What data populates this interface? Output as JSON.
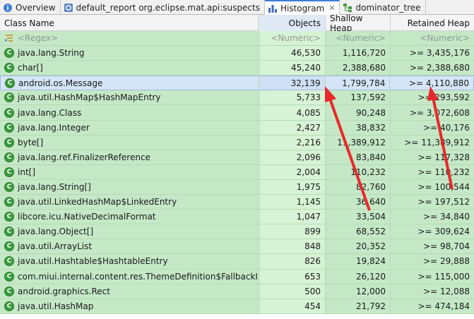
{
  "tabs": [
    {
      "label": "Overview",
      "icon": "info-icon",
      "active": false
    },
    {
      "label": "default_report  org.eclipse.mat.api:suspects",
      "icon": "report-icon",
      "active": false
    },
    {
      "label": "Histogram",
      "icon": "histogram-icon",
      "active": true,
      "close": "✕"
    },
    {
      "label": "dominator_tree",
      "icon": "tree-icon",
      "active": false
    }
  ],
  "columns": {
    "class_name": "Class Name",
    "objects": "Objects",
    "shallow_heap": "Shallow Heap",
    "retained_heap": "Retained Heap"
  },
  "filter_row": {
    "class_name": "<Regex>",
    "objects": "<Numeric>",
    "shallow_heap": "<Numeric>",
    "retained_heap": "<Numeric>"
  },
  "rows": [
    {
      "name": "java.lang.String",
      "objects": "46,530",
      "shallow": "1,116,720",
      "retained": ">= 3,435,176"
    },
    {
      "name": "char[]",
      "objects": "45,240",
      "shallow": "2,388,680",
      "retained": ">= 2,388,680"
    },
    {
      "name": "android.os.Message",
      "objects": "32,139",
      "shallow": "1,799,784",
      "retained": ">= 4,110,880",
      "selected": true
    },
    {
      "name": "java.util.HashMap$HashMapEntry",
      "objects": "5,733",
      "shallow": "137,592",
      "retained": ">= 293,592"
    },
    {
      "name": "java.lang.Class",
      "objects": "4,085",
      "shallow": "90,248",
      "retained": ">= 3,072,608"
    },
    {
      "name": "java.lang.Integer",
      "objects": "2,427",
      "shallow": "38,832",
      "retained": ">= 40,176"
    },
    {
      "name": "byte[]",
      "objects": "2,216",
      "shallow": "11,389,912",
      "retained": ">= 11,389,912"
    },
    {
      "name": "java.lang.ref.FinalizerReference",
      "objects": "2,096",
      "shallow": "83,840",
      "retained": ">= 117,328"
    },
    {
      "name": "int[]",
      "objects": "2,004",
      "shallow": "110,232",
      "retained": ">= 110,232"
    },
    {
      "name": "java.lang.String[]",
      "objects": "1,975",
      "shallow": "82,760",
      "retained": ">= 100,544"
    },
    {
      "name": "java.util.LinkedHashMap$LinkedEntry",
      "objects": "1,145",
      "shallow": "36,640",
      "retained": ">= 197,512"
    },
    {
      "name": "libcore.icu.NativeDecimalFormat",
      "objects": "1,047",
      "shallow": "33,504",
      "retained": ">= 34,840"
    },
    {
      "name": "java.lang.Object[]",
      "objects": "899",
      "shallow": "68,552",
      "retained": ">= 309,624"
    },
    {
      "name": "java.util.ArrayList",
      "objects": "848",
      "shallow": "20,352",
      "retained": ">= 98,704"
    },
    {
      "name": "java.util.Hashtable$HashtableEntry",
      "objects": "826",
      "shallow": "19,824",
      "retained": ">= 29,888"
    },
    {
      "name": "com.miui.internal.content.res.ThemeDefinition$FallbackInfo",
      "objects": "653",
      "shallow": "26,120",
      "retained": ">= 115,000"
    },
    {
      "name": "android.graphics.Rect",
      "objects": "500",
      "shallow": "12,000",
      "retained": ">= 12,088"
    },
    {
      "name": "java.util.HashMap",
      "objects": "454",
      "shallow": "21,792",
      "retained": ">= 474,184"
    }
  ],
  "colors": {
    "row_green": "#c5e8c6",
    "objects_column_green": "#d7f3d5",
    "selection_blue": "#d4e5f7",
    "annotation_red": "#e8282b",
    "class_icon_green": "#3a9c3d"
  }
}
